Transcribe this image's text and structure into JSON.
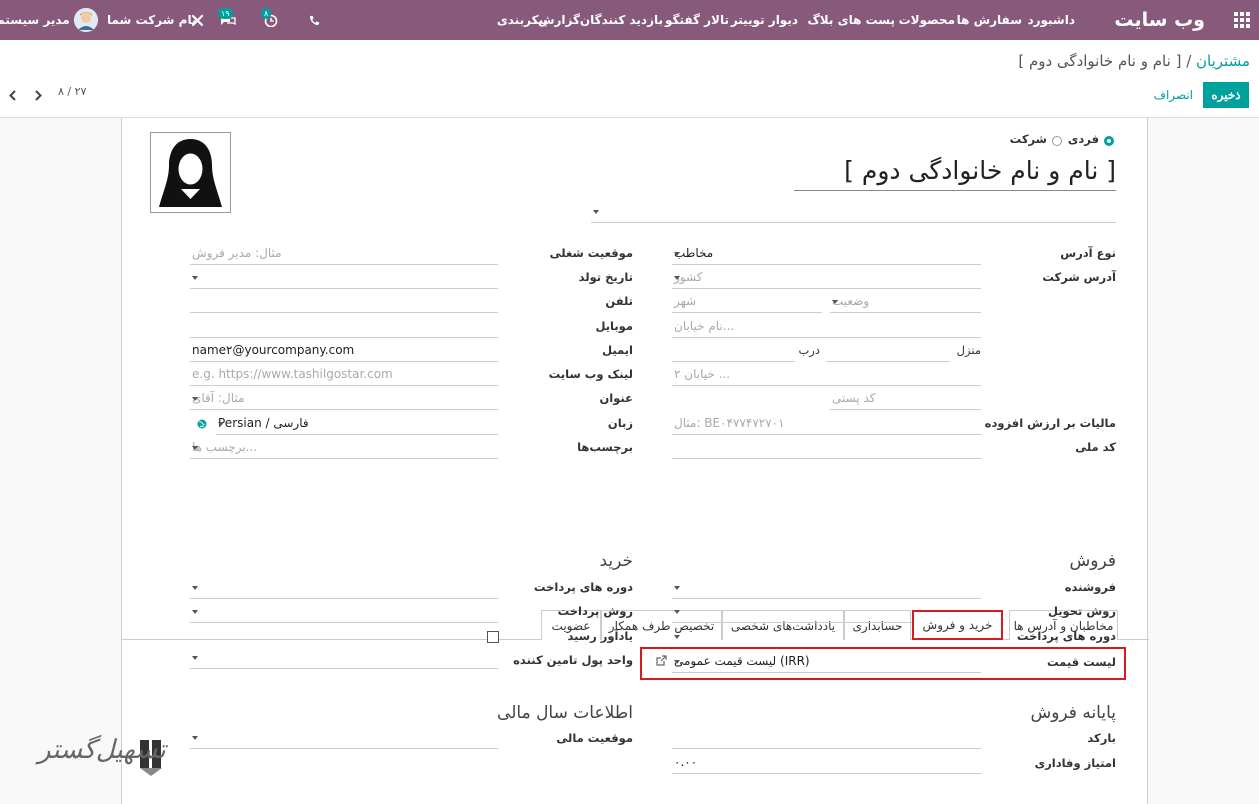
{
  "navbar": {
    "brand": "وب سایت",
    "menu": [
      "داشبورد",
      "سفارش ها",
      "محصولات",
      "پست های بلاگ",
      "دیوار توییتر",
      "تالار گفتگو",
      "بازدید کنندگان",
      "گزارش",
      "پیکربندی"
    ],
    "activity_badge": "۸",
    "messages_badge": "۱۹",
    "company": "نام شرکت شما",
    "user": "مدیر سیستم"
  },
  "control_panel": {
    "breadcrumb_parent": "مشتریان",
    "breadcrumb_sep": " / ",
    "breadcrumb_current": "[ نام و نام خانوادگی دوم ]",
    "save": "ذخیره",
    "discard": "انصراف",
    "pager": "۸ / ۲۷"
  },
  "form": {
    "radio_individual": "فردی",
    "radio_company": "شرکت",
    "name": "[ نام و نام خانوادگی دوم ]",
    "right_labels": {
      "address_type": "نوع آدرس",
      "company_address": "آدرس شرکت",
      "house": "منزل",
      "vat": "مالیات بر ارزش افزوده",
      "national_code": "کد ملی"
    },
    "right_values": {
      "address_type": "مخاطب",
      "door": "درب"
    },
    "right_placeholders": {
      "country": "کشور",
      "state": "وضعیت",
      "city": "شهر",
      "street": "نام خیابان...",
      "street2": "خیابان ۲ ...",
      "zip": "کد پستی",
      "vat": "مثال: BE۰۴۷۷۴۷۲۷۰۱"
    },
    "left_labels": {
      "job": "موقعیت شغلی",
      "birthdate": "تاریخ تولد",
      "phone": "تلفن",
      "mobile": "موبایل",
      "email": "ایمیل",
      "website": "لینک وب سایت",
      "title": "عنوان",
      "language": "زبان",
      "tags": "برچسب‌ها"
    },
    "left_values": {
      "email": "name۲@yourcompany.com",
      "language": "Persian / فارسی"
    },
    "left_placeholders": {
      "job": "مثال: مدیر فروش",
      "website": "e.g. https://www.tashilgostar.com",
      "title": "مثال: آقای",
      "tags": "برچسب ها..."
    }
  },
  "tabs": [
    "مخاطبان و آدرس ها",
    "خرید و فروش",
    "حسابداری",
    "یادداشت‌های شخصی",
    "تخصیص طرف همکار",
    "عضویت"
  ],
  "sales": {
    "title": "فروش",
    "salesperson": "فروشنده",
    "delivery_method": "روش تحویل",
    "payment_terms": "دوره های پرداخت",
    "pricelist": "لیست قیمت",
    "pricelist_value": "لیست قیمت عمومی (IRR)"
  },
  "purchase": {
    "title": "خرید",
    "payment_terms": "دوره های پرداخت",
    "payment_method": "روش پرداخت",
    "receipt_reminder": "یادآور رسید",
    "supplier_currency": "واحد پول تامین کننده"
  },
  "pos": {
    "title": "پایانه فروش",
    "barcode": "بارکد",
    "loyalty": "امتیاز وفاداری",
    "loyalty_value": "۰.۰۰"
  },
  "fiscal": {
    "title": "اطلاعات سال مالی",
    "position": "موقعیت مالی"
  },
  "watermark": "تسهیل‌گستر",
  "colors": {
    "navbar": "#875a7b",
    "accent": "#00a09d",
    "highlight": "#d71920"
  }
}
